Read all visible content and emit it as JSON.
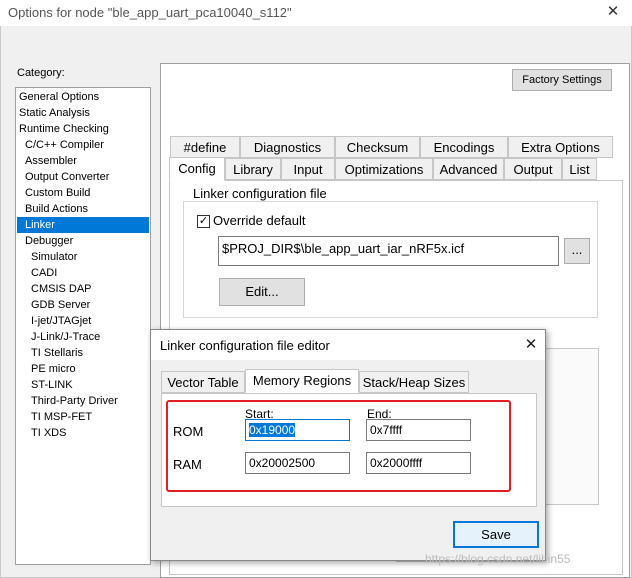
{
  "window": {
    "title": "Options for node \"ble_app_uart_pca10040_s112\"",
    "close_glyph": "✕"
  },
  "category": {
    "label": "Category:",
    "items": [
      {
        "label": "General Options"
      },
      {
        "label": "Static Analysis"
      },
      {
        "label": "Runtime Checking"
      },
      {
        "label": "C/C++ Compiler"
      },
      {
        "label": "Assembler"
      },
      {
        "label": "Output Converter"
      },
      {
        "label": "Custom Build"
      },
      {
        "label": "Build Actions"
      },
      {
        "label": "Linker"
      },
      {
        "label": "Debugger"
      },
      {
        "label": "Simulator"
      },
      {
        "label": "CADI"
      },
      {
        "label": "CMSIS DAP"
      },
      {
        "label": "GDB Server"
      },
      {
        "label": "I-jet/JTAGjet"
      },
      {
        "label": "J-Link/J-Trace"
      },
      {
        "label": "TI Stellaris"
      },
      {
        "label": "PE micro"
      },
      {
        "label": "ST-LINK"
      },
      {
        "label": "Third-Party Driver"
      },
      {
        "label": "TI MSP-FET"
      },
      {
        "label": "TI XDS"
      }
    ],
    "selected": "Linker"
  },
  "toolbar": {
    "factory_settings_label": "Factory Settings"
  },
  "tabs": {
    "row1": [
      "#define",
      "Diagnostics",
      "Checksum",
      "Encodings",
      "Extra Options"
    ],
    "row2": [
      "Config",
      "Library",
      "Input",
      "Optimizations",
      "Advanced",
      "Output",
      "List"
    ],
    "active": "Config"
  },
  "config": {
    "group_title": "Linker configuration file",
    "override_label": "Override default",
    "override_checked": true,
    "check_glyph": "✓",
    "path_value": "$PROJ_DIR$\\ble_app_uart_iar_nRF5x.icf",
    "browse_label": "...",
    "edit_label": "Edit..."
  },
  "dialog": {
    "title": "Linker configuration file editor",
    "close_glyph": "✕",
    "tabs": [
      "Vector Table",
      "Memory Regions",
      "Stack/Heap Sizes"
    ],
    "active_tab": "Memory Regions",
    "start_header": "Start:",
    "end_header": "End:",
    "rom_label": "ROM",
    "rom_start": "0x19000",
    "rom_end": "0x7ffff",
    "ram_label": "RAM",
    "ram_start": "0x20002500",
    "ram_end": "0x2000ffff",
    "save_label": "Save",
    "highlight_color": "#e02020",
    "accent_color": "#0078d7"
  },
  "watermark": "https://blog.csdn.net/libin55"
}
